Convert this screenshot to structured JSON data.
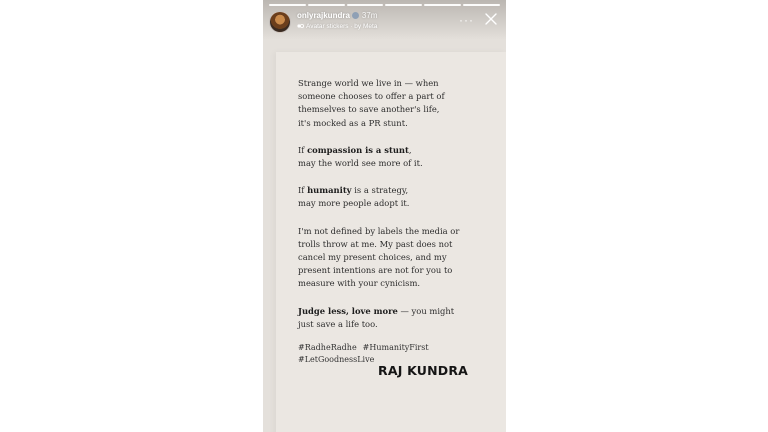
{
  "story": {
    "progress": {
      "segments_total": 6,
      "current_segment": 6
    },
    "header": {
      "username": "onlyrajkundra",
      "time_ago": "37m",
      "subline": "Avatar stickers · by Meta",
      "avatar_icon": "profile-avatar",
      "more_icon": "ellipsis-icon",
      "more_label": "···",
      "close_icon": "close-icon"
    },
    "post": {
      "p1": {
        "l1": "Strange world we live in — when",
        "l2": "someone chooses to offer a part of",
        "l3": "themselves to save another's life,",
        "l4": "it's mocked as a PR stunt."
      },
      "p2": {
        "l1_pre": "If ",
        "l1_bold": "compassion is a stunt",
        "l1_post": ",",
        "l2": "may the world see more of it."
      },
      "p3": {
        "l1_pre": "If ",
        "l1_bold": "humanity",
        "l1_post": " is a strategy,",
        "l2": "may more people adopt it."
      },
      "p4": {
        "l1": "I'm not defined by labels the media or",
        "l2": "trolls throw at me. My past does not",
        "l3": "cancel my present choices, and my",
        "l4": "present intentions are not for you to",
        "l5": "measure with your cynicism."
      },
      "p5": {
        "l1_bold": "Judge less, love more",
        "l1_post": " — you might",
        "l2": "just save a life too."
      },
      "hashtags": [
        "#RadheRadhe",
        "#HumanityFirst",
        "#LetGoodnessLive"
      ],
      "signature": "RAJ KUNDRA"
    },
    "colors": {
      "story_background": "#e4e0db",
      "paper": "#ebe7e2",
      "text": "#2d2d2d",
      "signature": "#151515"
    }
  }
}
